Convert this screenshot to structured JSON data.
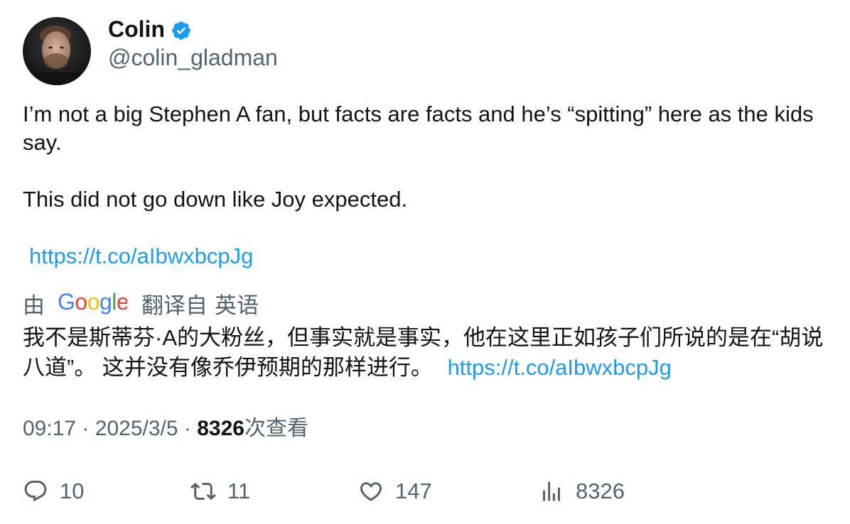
{
  "user": {
    "display_name": "Colin",
    "handle": "@colin_gladman",
    "avatar_icon": "avatar-photo",
    "verified_icon": "verified-badge-icon",
    "verified_color": "#1d9bf0"
  },
  "tweet": {
    "paragraph1": "I’m not a big Stephen A fan, but facts are facts and he’s “spitting” here as the kids say.",
    "paragraph2": "This did not go down like Joy expected.",
    "link": "https://t.co/aIbwxbcpJg"
  },
  "translation": {
    "by_label": "由",
    "provider": "Google",
    "from_label": "翻译自",
    "language": "英语",
    "text": "我不是斯蒂芬·A的大粉丝，但事实就是事实，他在这里正如孩子们所说的是在“胡说八道”。 这并没有像乔伊预期的那样进行。",
    "link": "https://t.co/aIbwxbcpJg"
  },
  "meta": {
    "time": "09:17",
    "separator": "·",
    "date": "2025/3/5",
    "views_count": "8326",
    "views_label": "次查看"
  },
  "actions": {
    "replies": "10",
    "reposts": "11",
    "likes": "147",
    "views": "8326",
    "icons": [
      "reply-icon",
      "repost-icon",
      "like-icon",
      "views-icon"
    ]
  },
  "colors": {
    "text": "#0f1419",
    "secondary": "#536471",
    "link": "#1d9bf0"
  }
}
